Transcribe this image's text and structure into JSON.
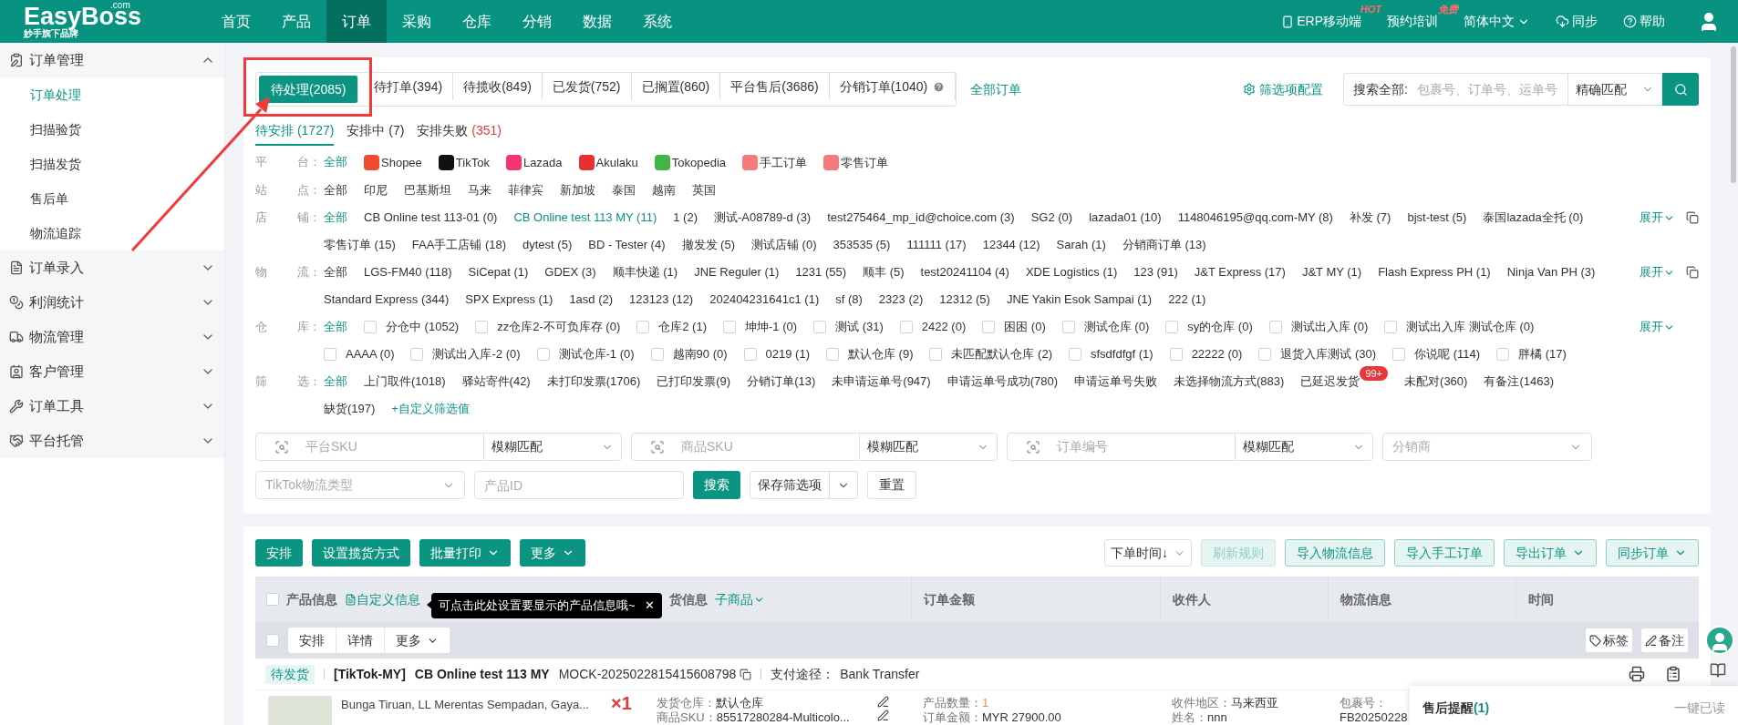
{
  "header": {
    "logo": "EasyBoss",
    "logo_suffix": ".com",
    "tagline": "妙手旗下品牌",
    "nav": [
      {
        "label": "首页",
        "selected": false
      },
      {
        "label": "产品",
        "selected": false
      },
      {
        "label": "订单",
        "selected": true
      },
      {
        "label": "采购",
        "selected": false
      },
      {
        "label": "仓库",
        "selected": false
      },
      {
        "label": "分销",
        "selected": false
      },
      {
        "label": "数据",
        "selected": false
      },
      {
        "label": "系统",
        "selected": false
      }
    ],
    "tools": [
      {
        "kind": "mobile",
        "label": "ERP移动端",
        "badge": "HOT"
      },
      {
        "kind": "plain",
        "label": "预约培训",
        "badge": "免费"
      },
      {
        "kind": "dropdown",
        "label": "简体中文"
      },
      {
        "kind": "sync",
        "label": "同步"
      },
      {
        "kind": "help",
        "label": "帮助"
      }
    ]
  },
  "sidebar": [
    {
      "label": "订单管理",
      "expanded": true,
      "children": [
        {
          "label": "订单处理",
          "selected": true
        },
        {
          "label": "扫描验货",
          "selected": false
        },
        {
          "label": "扫描发货",
          "selected": false
        },
        {
          "label": "售后单",
          "selected": false
        },
        {
          "label": "物流追踪",
          "selected": false
        }
      ]
    },
    {
      "label": "订单录入",
      "expanded": false
    },
    {
      "label": "利润统计",
      "expanded": false
    },
    {
      "label": "物流管理",
      "expanded": false
    },
    {
      "label": "客户管理",
      "expanded": false
    },
    {
      "label": "订单工具",
      "expanded": false
    },
    {
      "label": "平台托管",
      "expanded": false
    }
  ],
  "status_tabs": [
    {
      "label": "待处理(2085)",
      "selected": true,
      "help": false
    },
    {
      "label": "待打单(394)",
      "selected": false,
      "help": false
    },
    {
      "label": "待揽收(849)",
      "selected": false,
      "help": false
    },
    {
      "label": "已发货(752)",
      "selected": false,
      "help": false
    },
    {
      "label": "已搁置(860)",
      "selected": false,
      "help": false
    },
    {
      "label": "平台售后(3686)",
      "selected": false,
      "help": false
    },
    {
      "label": "分销订单(1040)",
      "selected": false,
      "help": true
    }
  ],
  "all_orders_link": "全部订单",
  "filter_config": "筛选项配置",
  "search": {
    "label": "搜索全部:",
    "placeholder": "包裹号、订单号、运单号",
    "match": "精确匹配"
  },
  "sub_tabs": [
    {
      "label": "待安排",
      "count": "(1727)",
      "selected": true,
      "alert": false
    },
    {
      "label": "安排中",
      "count": "(7)",
      "selected": false,
      "alert": false
    },
    {
      "label": "安排失败",
      "count": "(351)",
      "selected": false,
      "alert": true
    }
  ],
  "filters": [
    {
      "label": [
        "平",
        "台："
      ],
      "copy": false,
      "items": [
        {
          "kind": "plain",
          "text": "全部",
          "selected": true
        },
        {
          "kind": "platform",
          "text": "Shopee",
          "selected": false,
          "color": "#ee4d2d"
        },
        {
          "kind": "platform",
          "text": "TikTok",
          "selected": false,
          "color": "#111111"
        },
        {
          "kind": "platform",
          "text": "Lazada",
          "selected": false,
          "color": "#f5356e"
        },
        {
          "kind": "platform",
          "text": "Akulaku",
          "selected": false,
          "color": "#e8312f"
        },
        {
          "kind": "platform",
          "text": "Tokopedia",
          "selected": false,
          "color": "#42b549"
        },
        {
          "kind": "platform",
          "text": "手工订单",
          "selected": false,
          "color": "#f47b7b"
        },
        {
          "kind": "platform",
          "text": "零售订单",
          "selected": false,
          "color": "#f47b7b"
        }
      ]
    },
    {
      "label": [
        "站",
        "点："
      ],
      "copy": false,
      "items": [
        {
          "kind": "plain",
          "text": "全部",
          "selected": false
        },
        {
          "kind": "plain",
          "text": "印尼",
          "selected": false
        },
        {
          "kind": "plain",
          "text": "巴基斯坦",
          "selected": false
        },
        {
          "kind": "plain",
          "text": "马来",
          "selected": false
        },
        {
          "kind": "plain",
          "text": "菲律宾",
          "selected": false
        },
        {
          "kind": "plain",
          "text": "新加坡",
          "selected": false
        },
        {
          "kind": "plain",
          "text": "泰国",
          "selected": false
        },
        {
          "kind": "plain",
          "text": "越南",
          "selected": false
        },
        {
          "kind": "plain",
          "text": "英国",
          "selected": false
        }
      ]
    },
    {
      "label": [
        "店",
        "铺："
      ],
      "expand": "展开",
      "copy": true,
      "items": [
        {
          "kind": "plain",
          "text": "全部",
          "selected": true
        },
        {
          "kind": "plain",
          "text": "CB Online test 113-01 (0)",
          "selected": false
        },
        {
          "kind": "plain",
          "text": "CB Online test 113 MY (11)",
          "selected": true
        },
        {
          "kind": "plain",
          "text": "1 (2)",
          "selected": false
        },
        {
          "kind": "plain",
          "text": "测试-A08789-d (3)",
          "selected": false
        },
        {
          "kind": "plain",
          "text": "test275464_mp_id@choice.com (3)",
          "selected": false
        },
        {
          "kind": "plain",
          "text": "SG2 (0)",
          "selected": false
        },
        {
          "kind": "plain",
          "text": "lazada01 (10)",
          "selected": false
        },
        {
          "kind": "plain",
          "text": "1148046195@qq.com-MY (8)",
          "selected": false
        },
        {
          "kind": "plain",
          "text": "补发 (7)",
          "selected": false
        },
        {
          "kind": "plain",
          "text": "bjst-test (5)",
          "selected": false
        },
        {
          "kind": "plain",
          "text": "泰国lazada全托 (0)",
          "selected": false
        },
        {
          "kind": "plain",
          "text": "零售订单 (15)",
          "selected": false
        },
        {
          "kind": "plain",
          "text": "FAA手工店铺 (18)",
          "selected": false
        },
        {
          "kind": "plain",
          "text": "dytest (5)",
          "selected": false
        },
        {
          "kind": "plain",
          "text": "BD - Tester (4)",
          "selected": false
        },
        {
          "kind": "plain",
          "text": "撤发发 (5)",
          "selected": false
        },
        {
          "kind": "plain",
          "text": "测试店铺 (0)",
          "selected": false
        },
        {
          "kind": "plain",
          "text": "353535 (5)",
          "selected": false
        },
        {
          "kind": "plain",
          "text": "111111 (17)",
          "selected": false
        },
        {
          "kind": "plain",
          "text": "12344 (12)",
          "selected": false
        },
        {
          "kind": "plain",
          "text": "Sarah (1)",
          "selected": false
        },
        {
          "kind": "plain",
          "text": "分销商订单 (13)",
          "selected": false
        }
      ]
    },
    {
      "label": [
        "物",
        "流："
      ],
      "expand": "展开",
      "copy": true,
      "items": [
        {
          "kind": "plain",
          "text": "全部",
          "selected": false
        },
        {
          "kind": "plain",
          "text": "LGS-FM40 (118)",
          "selected": false
        },
        {
          "kind": "plain",
          "text": "SiCepat (1)",
          "selected": false
        },
        {
          "kind": "plain",
          "text": "GDEX (3)",
          "selected": false
        },
        {
          "kind": "plain",
          "text": "顺丰快递 (1)",
          "selected": false
        },
        {
          "kind": "plain",
          "text": "JNE Reguler (1)",
          "selected": false
        },
        {
          "kind": "plain",
          "text": "1231 (55)",
          "selected": false
        },
        {
          "kind": "plain",
          "text": "顺丰 (5)",
          "selected": false
        },
        {
          "kind": "plain",
          "text": "test20241104 (4)",
          "selected": false
        },
        {
          "kind": "plain",
          "text": "XDE Logistics (1)",
          "selected": false
        },
        {
          "kind": "plain",
          "text": "123 (91)",
          "selected": false
        },
        {
          "kind": "plain",
          "text": "J&T Express (17)",
          "selected": false
        },
        {
          "kind": "plain",
          "text": "J&T MY (1)",
          "selected": false
        },
        {
          "kind": "plain",
          "text": "Flash Express PH (1)",
          "selected": false
        },
        {
          "kind": "plain",
          "text": "Ninja Van PH (3)",
          "selected": false
        },
        {
          "kind": "plain",
          "text": "Standard Express (344)",
          "selected": false
        },
        {
          "kind": "plain",
          "text": "SPX Express (1)",
          "selected": false
        },
        {
          "kind": "plain",
          "text": "1asd (2)",
          "selected": false
        },
        {
          "kind": "plain",
          "text": "123123 (12)",
          "selected": false
        },
        {
          "kind": "plain",
          "text": "202404231641c1 (1)",
          "selected": false
        },
        {
          "kind": "plain",
          "text": "sf (8)",
          "selected": false
        },
        {
          "kind": "plain",
          "text": "2323 (2)",
          "selected": false
        },
        {
          "kind": "plain",
          "text": "12312 (5)",
          "selected": false
        },
        {
          "kind": "plain",
          "text": "JNE Yakin Esok Sampai (1)",
          "selected": false
        },
        {
          "kind": "plain",
          "text": "222 (1)",
          "selected": false
        }
      ]
    },
    {
      "label": [
        "仓",
        "库："
      ],
      "expand": "展开",
      "copy": false,
      "items": [
        {
          "kind": "plain",
          "text": "全部",
          "selected": true
        },
        {
          "kind": "checkbox",
          "text": "分仓中 (1052)",
          "checked": false
        },
        {
          "kind": "checkbox",
          "text": "zz仓库2-不可负库存 (0)",
          "checked": false
        },
        {
          "kind": "checkbox",
          "text": "仓库2 (1)",
          "checked": false
        },
        {
          "kind": "checkbox",
          "text": "坤坤-1 (0)",
          "checked": false
        },
        {
          "kind": "checkbox",
          "text": "测试 (31)",
          "checked": false
        },
        {
          "kind": "checkbox",
          "text": "2422 (0)",
          "checked": false
        },
        {
          "kind": "checkbox",
          "text": "困困 (0)",
          "checked": false
        },
        {
          "kind": "checkbox",
          "text": "测试仓库 (0)",
          "checked": false
        },
        {
          "kind": "checkbox",
          "text": "sy的仓库 (0)",
          "checked": false
        },
        {
          "kind": "checkbox",
          "text": "测试出入库 (0)",
          "checked": false
        },
        {
          "kind": "checkbox",
          "text": "测试出入库 测试仓库 (0)",
          "checked": false
        },
        {
          "kind": "checkbox",
          "text": "AAAA (0)",
          "checked": false
        },
        {
          "kind": "checkbox",
          "text": "测试出入库-2 (0)",
          "checked": false
        },
        {
          "kind": "checkbox",
          "text": "测试仓库-1 (0)",
          "checked": false
        },
        {
          "kind": "checkbox",
          "text": "越南90 (0)",
          "checked": false
        },
        {
          "kind": "checkbox",
          "text": "0219 (1)",
          "checked": false
        },
        {
          "kind": "checkbox",
          "text": "默认仓库 (9)",
          "checked": false
        },
        {
          "kind": "checkbox",
          "text": "未匹配默认仓库 (2)",
          "checked": false
        },
        {
          "kind": "checkbox",
          "text": "sfsdfdfgf (1)",
          "checked": false
        },
        {
          "kind": "checkbox",
          "text": "22222 (0)",
          "checked": false
        },
        {
          "kind": "checkbox",
          "text": "退货入库测试 (30)",
          "checked": false
        },
        {
          "kind": "checkbox",
          "text": "你说呢 (114)",
          "checked": false
        },
        {
          "kind": "checkbox",
          "text": "胖橘 (17)",
          "checked": false
        }
      ]
    },
    {
      "label": [
        "筛",
        "选："
      ],
      "copy": false,
      "items": [
        {
          "kind": "plain",
          "text": "全部",
          "selected": true
        },
        {
          "kind": "plain",
          "text": "上门取件(1018)",
          "selected": false
        },
        {
          "kind": "plain",
          "text": "驿站寄件(42)",
          "selected": false
        },
        {
          "kind": "plain",
          "text": "未打印发票(1706)",
          "selected": false
        },
        {
          "kind": "plain",
          "text": "已打印发票(9)",
          "selected": false
        },
        {
          "kind": "plain",
          "text": "分销订单(13)",
          "selected": false
        },
        {
          "kind": "plain",
          "text": "未申请运单号(947)",
          "selected": false
        },
        {
          "kind": "plain",
          "text": "申请运单号成功(780)",
          "selected": false
        },
        {
          "kind": "plain",
          "text": "申请运单号失败",
          "selected": false
        },
        {
          "kind": "plain",
          "text": "未选择物流方式(883)",
          "selected": false
        },
        {
          "kind": "plain",
          "text": "已延迟发货",
          "selected": false,
          "badge": "99+"
        },
        {
          "kind": "plain",
          "text": "未配对(360)",
          "selected": false
        },
        {
          "kind": "plain",
          "text": "有备注(1463)",
          "selected": false
        },
        {
          "kind": "plain",
          "text": "缺货(197)",
          "selected": false
        },
        {
          "kind": "link",
          "text": "+自定义筛选值"
        }
      ]
    }
  ],
  "search_rows": [
    [
      {
        "kind": "search",
        "placeholder": "平台SKU",
        "match": "模糊匹配"
      },
      {
        "kind": "search",
        "placeholder": "商品SKU",
        "match": "模糊匹配"
      },
      {
        "kind": "search",
        "placeholder": "订单编号",
        "match": "模糊匹配"
      },
      {
        "kind": "select",
        "placeholder": "分销商"
      }
    ],
    [
      {
        "kind": "select",
        "placeholder": "TikTok物流类型"
      },
      {
        "kind": "input",
        "placeholder": "产品ID"
      },
      {
        "kind": "primary",
        "label": "搜索"
      },
      {
        "kind": "split",
        "label": "保存筛选项"
      },
      {
        "kind": "plain",
        "label": "重置"
      }
    ]
  ],
  "toolbar": {
    "left": [
      {
        "label": "安排",
        "dropdown": false
      },
      {
        "label": "设置揽货方式",
        "dropdown": false
      },
      {
        "label": "批量打印",
        "dropdown": true
      },
      {
        "label": "更多",
        "dropdown": true
      }
    ],
    "sort": "下单时间↓",
    "right": [
      {
        "label": "刷新规则",
        "disabled": true,
        "dropdown": false
      },
      {
        "label": "导入物流信息",
        "disabled": false,
        "dropdown": false
      },
      {
        "label": "导入手工订单",
        "disabled": false,
        "dropdown": false
      },
      {
        "label": "导出订单",
        "disabled": false,
        "dropdown": true
      },
      {
        "label": "同步订单",
        "disabled": false,
        "dropdown": true
      }
    ]
  },
  "table": {
    "checked": false,
    "product_column": "产品信息",
    "custom_link": "自定义信息",
    "tooltip": "可点击此处设置要显示的产品信息哦~",
    "tooltip_close": "✕",
    "partial_column": "货信息",
    "sub_link": "子商品",
    "columns": [
      "订单金额",
      "收件人",
      "物流信息",
      "时间"
    ]
  },
  "batch_bar": {
    "checked": false,
    "buttons": [
      {
        "label": "安排",
        "dropdown": false
      },
      {
        "label": "详情",
        "dropdown": false
      },
      {
        "label": "更多",
        "dropdown": true
      }
    ],
    "right": [
      {
        "kind": "tag",
        "label": "标签"
      },
      {
        "kind": "note",
        "label": "备注"
      }
    ]
  },
  "order": {
    "status": "待发货",
    "platform": "[TikTok-MY]",
    "shop": "CB Online test 113 MY",
    "order_no": "MOCK-2025022815415608798",
    "pay_label": "支付途径：",
    "pay": "Bank Transfer"
  },
  "product": {
    "title": "Bunga Tiruan, LL Merentas Sempadan, Gaya...",
    "qty": "×1",
    "warehouse_label": "发货仓库：",
    "warehouse": "默认仓库",
    "sku_label": "商品SKU：",
    "sku": "85517280284-Multicolo...",
    "count_label": "产品数量：",
    "count": "1",
    "amount_label": "订单金额：",
    "amount": "MYR 27900.00",
    "region_label": "收件地区：",
    "region": "马来西亚",
    "name_label": "姓名：",
    "name": "nnn",
    "package_label": "包裹号：",
    "package": "FB20250228"
  },
  "after_sales": {
    "title": "售后提醒",
    "count": "(1)",
    "action": "一键已读"
  }
}
